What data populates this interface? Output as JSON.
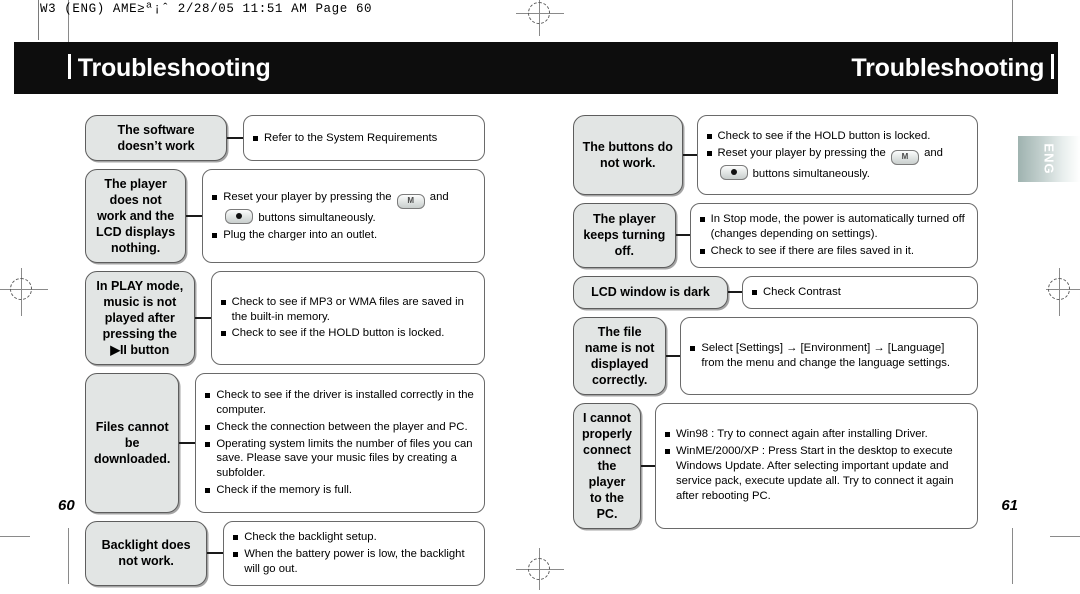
{
  "film_header": {
    "text": "W3 (ENG) AME≥ª¡ˆ  2/28/05 11:51 AM  Page 60"
  },
  "band": {
    "title_left": "Troubleshooting",
    "title_right": "Troubleshooting"
  },
  "side_tab": {
    "label": "ENG"
  },
  "page_numbers": {
    "left": "60",
    "right": "61"
  },
  "left_column": [
    {
      "symptom": "The software doesn’t work",
      "bullets": [
        {
          "text": "Refer to the System Requirements"
        }
      ]
    },
    {
      "symptom": "The player does not work and the LCD displays nothing.",
      "bullets": [
        {
          "pre": "Reset your player by pressing the ",
          "key_m": "M",
          "mid": " and ",
          "key_rec": "record-dot",
          "post": " buttons simultaneously."
        },
        {
          "text": "Plug the charger into an outlet."
        }
      ]
    },
    {
      "symptom": "In PLAY mode, music is not played after pressing the ▶II button",
      "bullets": [
        {
          "text": "Check to see if MP3 or WMA  files are saved in the built-in memory."
        },
        {
          "text": "Check to see if the HOLD button is locked."
        }
      ]
    },
    {
      "symptom": "Files cannot be downloaded.",
      "bullets": [
        {
          "text": "Check to see if the driver is installed correctly in the computer."
        },
        {
          "text": "Check the connection between the player and PC."
        },
        {
          "text": "Operating system limits the number of files you can save. Please save your music files by creating a subfolder."
        },
        {
          "text": "Check if the memory is full."
        }
      ]
    },
    {
      "symptom": "Backlight does not work.",
      "bullets": [
        {
          "text": "Check the backlight setup."
        },
        {
          "text": "When the battery power is low, the backlight will go out."
        }
      ]
    }
  ],
  "right_column": [
    {
      "symptom": "The buttons do not work.",
      "bullets": [
        {
          "text": "Check to see if the HOLD button is locked."
        },
        {
          "pre": "Reset your player by pressing the ",
          "key_m": "M",
          "mid": " and ",
          "key_rec": "record-dot",
          "post": " buttons simultaneously."
        }
      ]
    },
    {
      "symptom": "The player keeps turning off.",
      "bullets": [
        {
          "text": "In Stop mode, the power is automatically turned off (changes depending on settings)."
        },
        {
          "text": "Check to see if there are files saved in it."
        }
      ]
    },
    {
      "symptom": "LCD window is dark",
      "bullets": [
        {
          "text": "Check Contrast"
        }
      ]
    },
    {
      "symptom": "The file name is not displayed correctly.",
      "bullets": [
        {
          "text": "Select [Settings] → [Environment] → [Language] from the menu and change the language settings."
        }
      ]
    },
    {
      "symptom": "I cannot properly connect the player to the PC.",
      "bullets": [
        {
          "text": "Win98 : Try to connect again after installing Driver."
        },
        {
          "text": "WinME/2000/XP : Press Start in the desktop to execute Windows Update. After selecting important update and service pack, execute update all. Try to connect it again after rebooting PC."
        }
      ]
    }
  ]
}
